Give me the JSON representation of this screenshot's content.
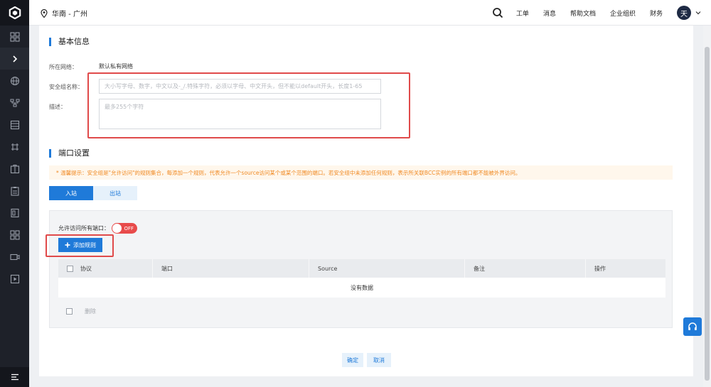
{
  "header": {
    "region": "华南 - 广州",
    "links": [
      "工单",
      "消息",
      "帮助文档",
      "企业组织",
      "财务"
    ],
    "avatar_initial": "天"
  },
  "sidebar": {
    "icons": [
      "grid-icon",
      "chevron-right-icon",
      "globe-icon",
      "network-icon",
      "storage-icon",
      "nodes-icon",
      "package-icon",
      "clipboard-icon",
      "document-icon",
      "apps-icon",
      "video-icon",
      "play-icon"
    ]
  },
  "basic_info": {
    "title": "基本信息",
    "network_label": "所在网络：",
    "network_value": "默认私有网络",
    "name_label": "安全组名称：",
    "name_placeholder": "大小写字母、数字，中文以及-_/.特殊字符，必须以字母、中文开头，但不能以default开头，长度1-65",
    "desc_label": "描述：",
    "desc_placeholder": "最多255个字符"
  },
  "port_settings": {
    "title": "端口设置",
    "tip": "* 温馨提示：安全组是\"允许访问\"的规则集合，每添加一个规则，代表允许一个source访问某个或某个范围的端口。若安全组中未添加任何规则，表示所关联BCC实例的所有端口都不能被外界访问。",
    "tabs": [
      {
        "label": "入站",
        "active": true
      },
      {
        "label": "出站",
        "active": false
      }
    ],
    "allow_all_label": "允许访问所有端口：",
    "toggle_label": "OFF",
    "add_rule_label": "添加规则",
    "columns": [
      "协议",
      "端口",
      "Source",
      "备注",
      "操作"
    ],
    "empty_text": "没有数据",
    "delete_label": "删除"
  },
  "footer": {
    "confirm_label": "确定",
    "cancel_label": "取消"
  },
  "colors": {
    "primary": "#1f7ad9",
    "toggle_off": "#e84b4b",
    "annotation": "#e04a4a",
    "tip_text": "#f08a24"
  }
}
